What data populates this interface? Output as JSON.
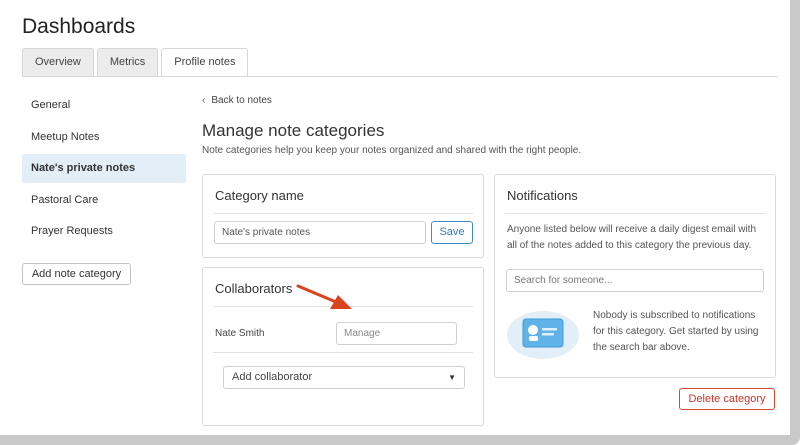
{
  "page": {
    "title": "Dashboards"
  },
  "tabs": [
    {
      "label": "Overview"
    },
    {
      "label": "Metrics"
    },
    {
      "label": "Profile notes"
    }
  ],
  "sidebar": {
    "items": [
      {
        "label": "General"
      },
      {
        "label": "Meetup Notes"
      },
      {
        "label": "Nate's private notes"
      },
      {
        "label": "Pastoral Care"
      },
      {
        "label": "Prayer Requests"
      }
    ],
    "add_button": "Add note category"
  },
  "main": {
    "back_label": "Back to notes",
    "title": "Manage note categories",
    "description": "Note categories help you keep your notes organized and shared with the right people."
  },
  "category_card": {
    "title": "Category name",
    "name_value": "Nate's private notes",
    "save_label": "Save"
  },
  "collaborators_card": {
    "title": "Collaborators",
    "collaborators": [
      {
        "name": "Nate Smith",
        "manage_placeholder": "Manage"
      }
    ],
    "add_select_label": "Add collaborator"
  },
  "notifications_card": {
    "title": "Notifications",
    "description_line1": "Anyone listed below will receive a daily digest email with",
    "description_line2": "all of the notes added to this category the previous day.",
    "search_placeholder": "Search for someone...",
    "empty_line1": "Nobody is subscribed to notifications",
    "empty_line2": "for this category. Get started by using",
    "empty_line3": "the search bar above."
  },
  "delete_label": "Delete category",
  "colors": {
    "accent": "#2f7bb8",
    "danger": "#c0392b",
    "active_bg": "#e3eff8",
    "annotation_arrow": "#d9441f"
  },
  "icons": {
    "back": "chevron-left-icon",
    "select_caret": "caret-down-icon",
    "empty_state": "contact-card-illustration",
    "annotation": "arrow-annotation"
  }
}
